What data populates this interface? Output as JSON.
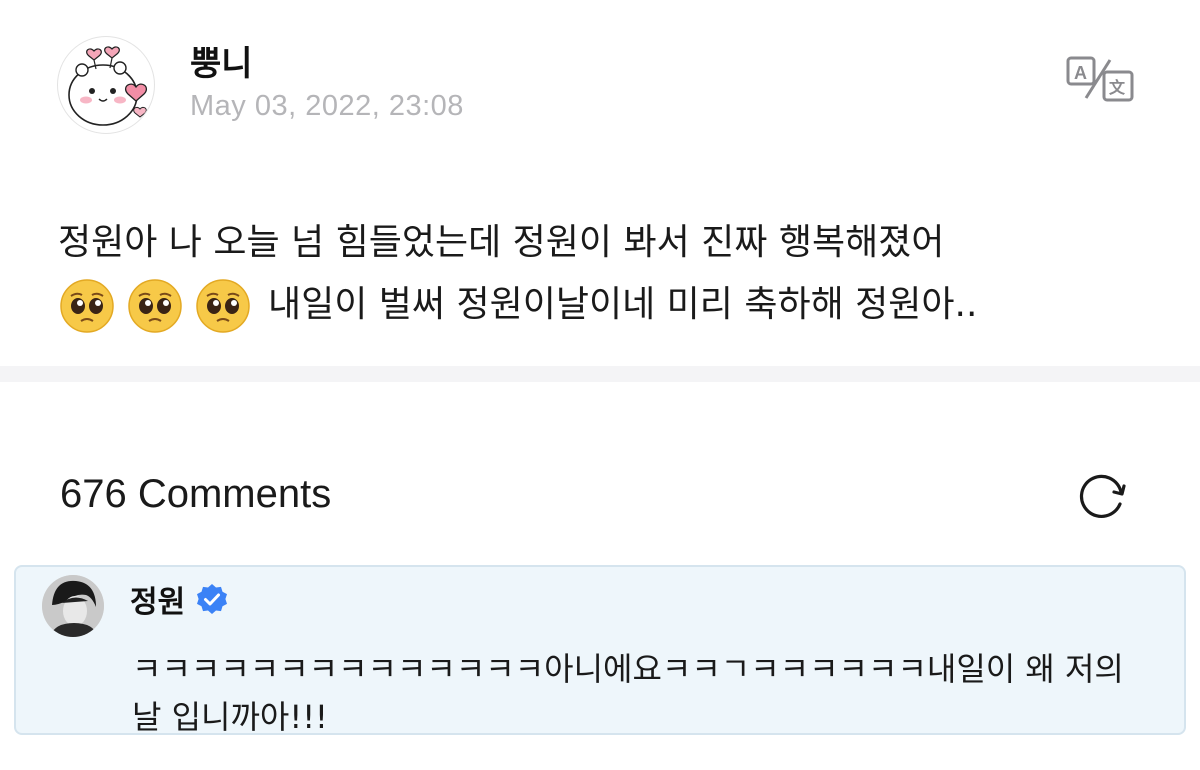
{
  "post": {
    "author": "뿡니",
    "timestamp": "May 03, 2022, 23:08",
    "translate_icon": "translate-icon",
    "emojis": [
      "pleading-face-emoji",
      "pleading-face-emoji",
      "pleading-face-emoji"
    ],
    "text_line1": "정원아 나 오늘 넘 힘들었는데 정원이 봐서 진짜 행복해졌어",
    "text_line2": "내일이 벌써 정원이날이네 미리 축하해 정원아.."
  },
  "comments": {
    "count_label": "676 Comments",
    "refresh_icon": "refresh-icon",
    "items": [
      {
        "author": "정원",
        "verified_icon": "verified-badge-icon",
        "text": "ㅋㅋㅋㅋㅋㅋㅋㅋㅋㅋㅋㅋㅋㅋ아니에요ㅋㅋㄱㅋㅋㅋㅋㅋㅋ내일이 왜 저의 날 입니까아!!!"
      }
    ]
  },
  "colors": {
    "timestamp": "#b5b5b8",
    "divider": "#f4f4f6",
    "highlight_bg": "#eef6fb",
    "verified": "#3b82f6"
  }
}
